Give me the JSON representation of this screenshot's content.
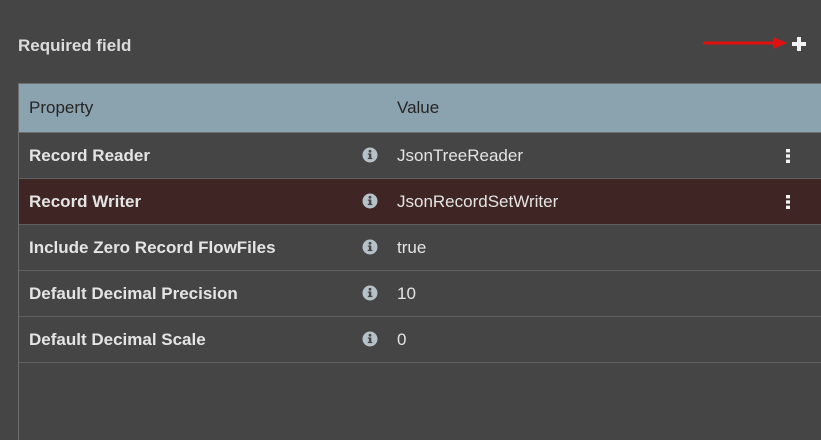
{
  "header": {
    "required_label": "Required field"
  },
  "icons": {
    "add": "plus-icon",
    "info": "info-circle-icon",
    "menu": "kebab-menu-icon",
    "annotation": "red-arrow-annotation"
  },
  "colors": {
    "background": "#454545",
    "table_header": "#8aa3af",
    "selected_row": "#3f2624",
    "arrow": "#e01010"
  },
  "table": {
    "columns": [
      "Property",
      "Value"
    ],
    "rows": [
      {
        "name": "Record Reader",
        "value": "JsonTreeReader",
        "selected": false,
        "has_menu": true
      },
      {
        "name": "Record Writer",
        "value": "JsonRecordSetWriter",
        "selected": true,
        "has_menu": true
      },
      {
        "name": "Include Zero Record FlowFiles",
        "value": "true",
        "selected": false,
        "has_menu": false
      },
      {
        "name": "Default Decimal Precision",
        "value": "10",
        "selected": false,
        "has_menu": false
      },
      {
        "name": "Default Decimal Scale",
        "value": "0",
        "selected": false,
        "has_menu": false
      }
    ]
  }
}
